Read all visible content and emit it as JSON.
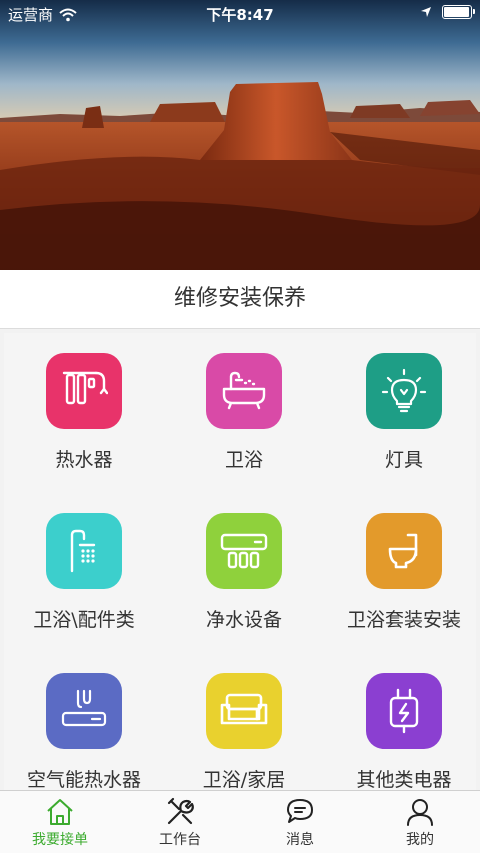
{
  "status_bar": {
    "carrier": "运营商",
    "time": "下午8:47",
    "battery_level": 0.95
  },
  "banner": {
    "image": "desert-mesa-photo"
  },
  "section": {
    "title": "维修安装保养"
  },
  "categories": [
    {
      "label": "热水器",
      "icon": "water-filter-icon",
      "color": "#e8336a"
    },
    {
      "label": "卫浴",
      "icon": "bathtub-icon",
      "color": "#d94aa7"
    },
    {
      "label": "灯具",
      "icon": "light-bulb-icon",
      "color": "#1e9e86"
    },
    {
      "label": "卫浴\\配件类",
      "icon": "shower-icon",
      "color": "#3ccfcc"
    },
    {
      "label": "净水设备",
      "icon": "water-purifier-icon",
      "color": "#8fd13c"
    },
    {
      "label": "卫浴套装安装",
      "icon": "toilet-icon",
      "color": "#e39a2b"
    },
    {
      "label": "空气能热水器",
      "icon": "air-heater-icon",
      "color": "#5b6bc4"
    },
    {
      "label": "卫浴/家居",
      "icon": "sofa-icon",
      "color": "#e9d12e"
    },
    {
      "label": "其他类电器",
      "icon": "plug-icon",
      "color": "#8b3fd1"
    }
  ],
  "tab_bar": {
    "tabs": [
      {
        "label": "我要接单",
        "icon": "home-icon",
        "active": true
      },
      {
        "label": "工作台",
        "icon": "tools-icon",
        "active": false
      },
      {
        "label": "消息",
        "icon": "message-icon",
        "active": false
      },
      {
        "label": "我的",
        "icon": "profile-icon",
        "active": false
      }
    ],
    "active_color": "#3cab2f"
  }
}
